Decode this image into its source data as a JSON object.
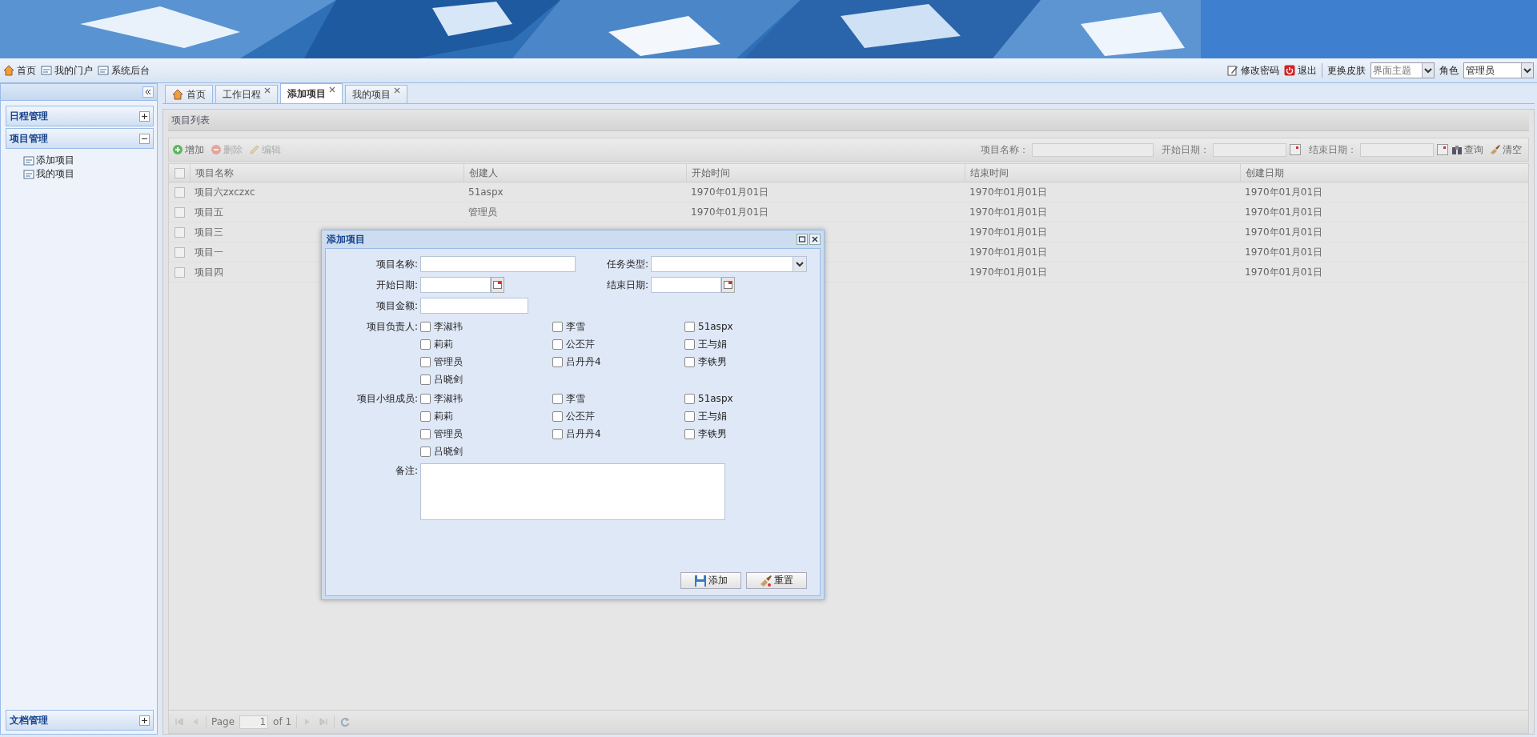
{
  "top_links": [
    {
      "label": "首页",
      "kind": "home"
    },
    {
      "label": "我的门户",
      "kind": "portal"
    },
    {
      "label": "系统后台",
      "kind": "portal"
    }
  ],
  "user_actions": {
    "change_password": "修改密码",
    "logout": "退出",
    "skin_label": "更换皮肤",
    "skin_select": {
      "placeholder": "界面主题"
    },
    "role_label": "角色",
    "role_select": {
      "value": "管理员"
    }
  },
  "sidebar": {
    "sections": [
      {
        "title": "日程管理",
        "expanded": false
      },
      {
        "title": "项目管理",
        "expanded": true,
        "items": [
          "添加项目",
          "我的项目"
        ]
      }
    ],
    "bottom_section": {
      "title": "文档管理",
      "expanded": false
    }
  },
  "tabs": [
    {
      "label": "首页",
      "kind": "home",
      "selected": false
    },
    {
      "label": "工作日程",
      "kind": "closable",
      "selected": false
    },
    {
      "label": "添加项目",
      "kind": "closable",
      "selected": true
    },
    {
      "label": "我的项目",
      "kind": "closable",
      "selected": false
    }
  ],
  "panel": {
    "title": "项目列表",
    "toolbar": {
      "buttons": [
        {
          "label": "增加",
          "kind": "add",
          "disabled": false
        },
        {
          "label": "删除",
          "kind": "delete",
          "disabled": true
        },
        {
          "label": "编辑",
          "kind": "edit",
          "disabled": true
        }
      ],
      "filters": [
        {
          "label": "项目名称：",
          "kind": "text"
        },
        {
          "label": "开始日期：",
          "kind": "date"
        },
        {
          "label": "结束日期：",
          "kind": "date"
        }
      ],
      "actions": [
        {
          "label": "查询",
          "kind": "search"
        },
        {
          "label": "清空",
          "kind": "clear"
        }
      ]
    },
    "table": {
      "select_all_checked": false,
      "columns": [
        "项目名称",
        "创建人",
        "开始时间",
        "结束时间",
        "创建日期"
      ],
      "rows": [
        {
          "checked": false,
          "cells": [
            "项目六zxczxc",
            "51aspx",
            "1970年01月01日",
            "1970年01月01日",
            "1970年01月01日"
          ]
        },
        {
          "checked": false,
          "cells": [
            "项目五",
            "管理员",
            "1970年01月01日",
            "1970年01月01日",
            "1970年01月01日"
          ]
        },
        {
          "checked": false,
          "cells": [
            "项目三",
            null,
            null,
            "1970年01月01日",
            "1970年01月01日"
          ]
        },
        {
          "checked": false,
          "cells": [
            "项目一",
            null,
            null,
            "1970年01月01日",
            "1970年01月01日"
          ]
        },
        {
          "checked": false,
          "cells": [
            "项目四",
            null,
            null,
            "1970年01月01日",
            "1970年01月01日"
          ]
        }
      ]
    },
    "pager": {
      "page_label": "Page",
      "page": "1",
      "of": "of 1"
    }
  },
  "dialog": {
    "title": "添加项目",
    "field_rows": [
      [
        {
          "label": "项目名称:",
          "kind": "text"
        },
        {
          "label": "任务类型:",
          "kind": "select"
        }
      ],
      [
        {
          "label": "开始日期:",
          "kind": "date"
        },
        {
          "label": "结束日期:",
          "kind": "date"
        }
      ],
      [
        {
          "label": "项目金额:",
          "kind": "money"
        }
      ]
    ],
    "check_groups": [
      {
        "label": "项目负责人:",
        "options": [
          {
            "label": "李淑祎",
            "checked": false
          },
          {
            "label": "李雪",
            "checked": false
          },
          {
            "label": "51aspx",
            "checked": false
          },
          {
            "label": "莉莉",
            "checked": false
          },
          {
            "label": "公丕芹",
            "checked": false
          },
          {
            "label": "王与娟",
            "checked": false
          },
          {
            "label": "管理员",
            "checked": false
          },
          {
            "label": "吕丹丹4",
            "checked": false
          },
          {
            "label": "李铁男",
            "checked": false
          },
          {
            "label": "吕晓剑",
            "checked": false
          }
        ]
      },
      {
        "label": "项目小组成员:",
        "options": [
          {
            "label": "李淑祎",
            "checked": false
          },
          {
            "label": "李雪",
            "checked": false
          },
          {
            "label": "51aspx",
            "checked": false
          },
          {
            "label": "莉莉",
            "checked": false
          },
          {
            "label": "公丕芹",
            "checked": false
          },
          {
            "label": "王与娟",
            "checked": false
          },
          {
            "label": "管理员",
            "checked": false
          },
          {
            "label": "吕丹丹4",
            "checked": false
          },
          {
            "label": "李铁男",
            "checked": false
          },
          {
            "label": "吕晓剑",
            "checked": false
          }
        ]
      }
    ],
    "remark": {
      "label": "备注:"
    },
    "buttons": [
      {
        "label": "添加",
        "kind": "save"
      },
      {
        "label": "重置",
        "kind": "reset"
      }
    ]
  }
}
